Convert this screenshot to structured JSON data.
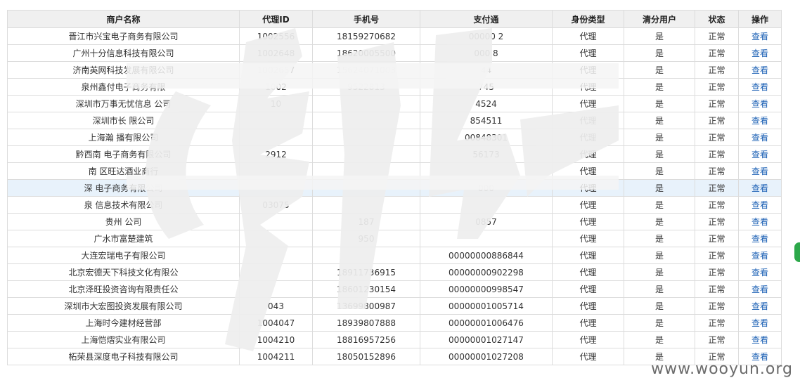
{
  "table": {
    "headers": [
      "商户名称",
      "代理ID",
      "手机号",
      "支付通",
      "身份类型",
      "清分用户",
      "状态",
      "操作"
    ],
    "rows": [
      [
        "晋江市兴宝电子商务有限公司",
        "1002556",
        "18159270682",
        "00000   2",
        "代理",
        "是",
        "正常",
        "查看"
      ],
      [
        "广州十分信息科技有限公司",
        "1002648",
        "18620005500",
        "000   8",
        "代理",
        "是",
        "正常",
        "查看"
      ],
      [
        "济南英网科技发展有限公司",
        "1002657",
        "15624071003",
        "   44",
        "代理",
        "是",
        "正常",
        "查看"
      ],
      [
        "泉州鑫付电子商务有限",
        "1002",
        "9522813",
        "   745",
        "代理",
        "是",
        "正常",
        "查看"
      ],
      [
        "深圳市万事无忧信息   公司",
        "10",
        "",
        "   4524",
        "代理",
        "是",
        "正常",
        "查看"
      ],
      [
        "深圳市长   限公司",
        "",
        "",
        "854511",
        "代理",
        "是",
        "正常",
        "查看"
      ],
      [
        "上海瀚   播有限公司",
        "",
        "",
        "00848301",
        "代理",
        "是",
        "正常",
        "查看"
      ],
      [
        "黔西南   电子商务有限公司",
        "2912",
        "",
        "56173",
        "代理",
        "是",
        "正常",
        "查看"
      ],
      [
        "南   区旺达酒业商行",
        "",
        "",
        "",
        "代理",
        "是",
        "正常",
        "查看"
      ],
      [
        "深   电子商务有限公司",
        "",
        "",
        "000",
        "代理",
        "是",
        "正常",
        "查看"
      ],
      [
        "泉   信息技术有限公司",
        "03075",
        "",
        "",
        "代理",
        "是",
        "正常",
        "查看"
      ],
      [
        "贵州   公司",
        "",
        "187",
        "0857",
        "代理",
        "是",
        "正常",
        "查看"
      ],
      [
        "广水市富楚建筑",
        "",
        "950",
        "",
        "代理",
        "是",
        "正常",
        "查看"
      ],
      [
        "大连宏瑞电子有限公司",
        "",
        "",
        "00000000886844",
        "代理",
        "是",
        "正常",
        "查看"
      ],
      [
        "北京宏德天下科技文化有限公",
        "",
        "18911736915",
        "00000000902298",
        "代理",
        "是",
        "正常",
        "查看"
      ],
      [
        "北京泽旺投资咨询有限责任公",
        "",
        "18601230154",
        "00000000998547",
        "代理",
        "是",
        "正常",
        "查看"
      ],
      [
        "深圳市大宏图投资发展有限公司",
        "043",
        "13699800987",
        "00000001005714",
        "代理",
        "是",
        "正常",
        "查看"
      ],
      [
        "上海时今建材经营部",
        "1004047",
        "18939807888",
        "00000001006476",
        "代理",
        "是",
        "正常",
        "查看"
      ],
      [
        "上海恺熠实业有限公司",
        "1004210",
        "18816957256",
        "00000001027147",
        "代理",
        "是",
        "正常",
        "查看"
      ],
      [
        "柘荣县深度电子科技有限公司",
        "1004211",
        "18050152896",
        "00000001027208",
        "代理",
        "是",
        "正常",
        "查看"
      ]
    ]
  },
  "watermark": "www.wooyun.org"
}
